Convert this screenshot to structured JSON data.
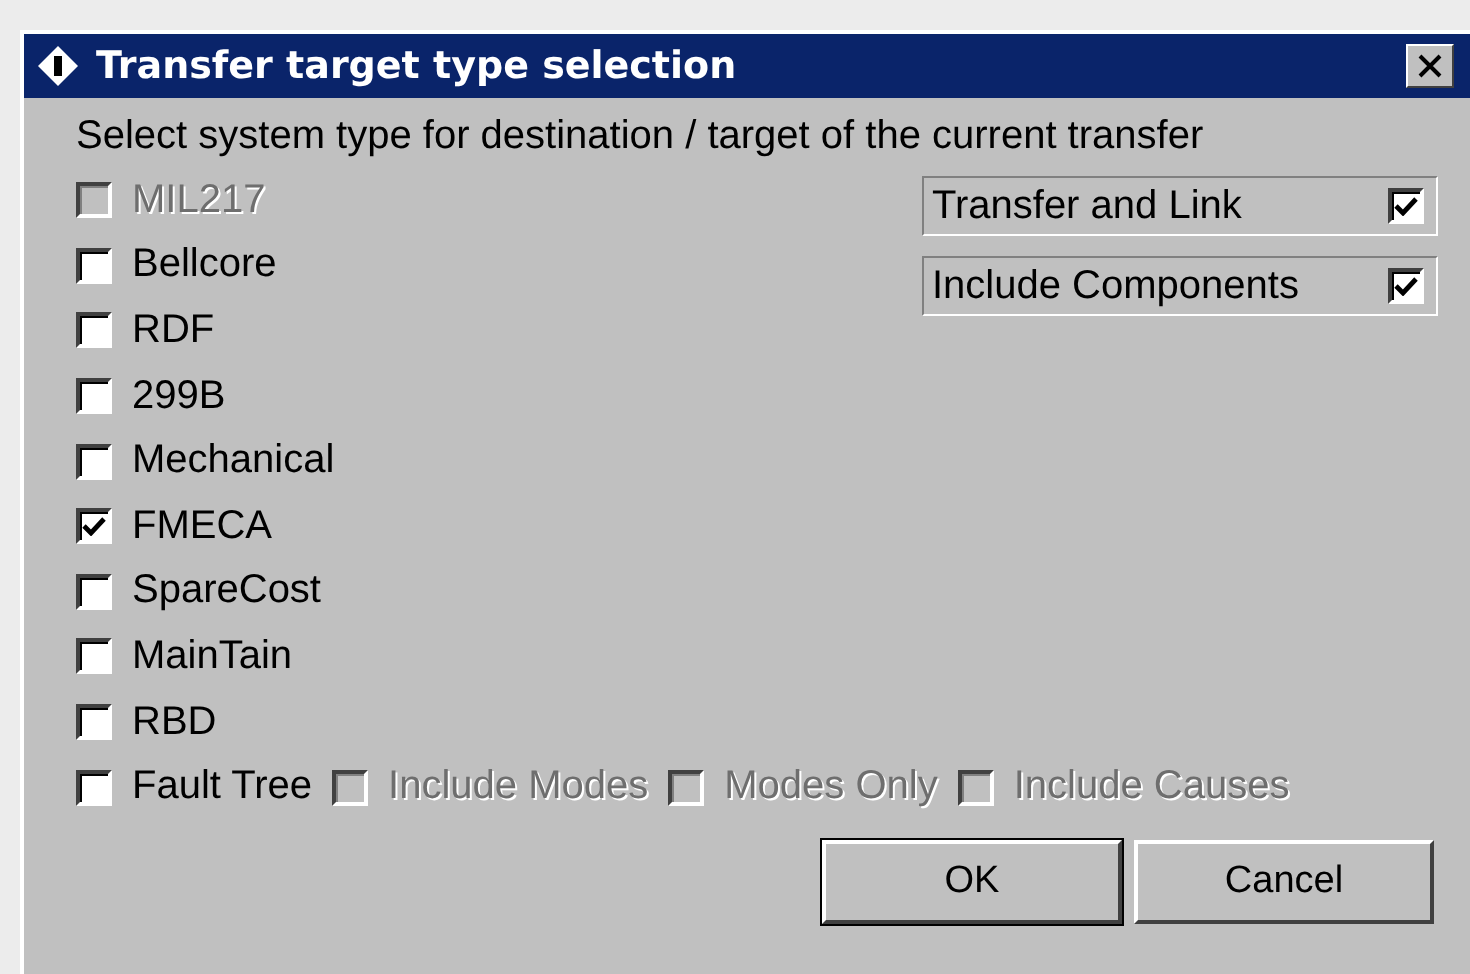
{
  "window": {
    "title": "Transfer target type selection"
  },
  "prompt": "Select system type for destination / target of the current transfer",
  "system_types": [
    {
      "label": "MIL217",
      "checked": false,
      "disabled": true
    },
    {
      "label": "Bellcore",
      "checked": false,
      "disabled": false
    },
    {
      "label": "RDF",
      "checked": false,
      "disabled": false
    },
    {
      "label": "299B",
      "checked": false,
      "disabled": false
    },
    {
      "label": "Mechanical",
      "checked": false,
      "disabled": false
    },
    {
      "label": "FMECA",
      "checked": true,
      "disabled": false
    },
    {
      "label": "SpareCost",
      "checked": false,
      "disabled": false
    },
    {
      "label": "MainTain",
      "checked": false,
      "disabled": false
    },
    {
      "label": "RBD",
      "checked": false,
      "disabled": false
    },
    {
      "label": "Fault Tree",
      "checked": false,
      "disabled": false,
      "suboptions": [
        {
          "label": "Include Modes",
          "checked": false,
          "disabled": true
        },
        {
          "label": "Modes Only",
          "checked": false,
          "disabled": true
        },
        {
          "label": "Include Causes",
          "checked": false,
          "disabled": true
        }
      ]
    }
  ],
  "options": [
    {
      "label": "Transfer and Link",
      "checked": true
    },
    {
      "label": "Include Components",
      "checked": true
    }
  ],
  "buttons": [
    {
      "label": "OK",
      "default": true
    },
    {
      "label": "Cancel",
      "default": false
    }
  ]
}
